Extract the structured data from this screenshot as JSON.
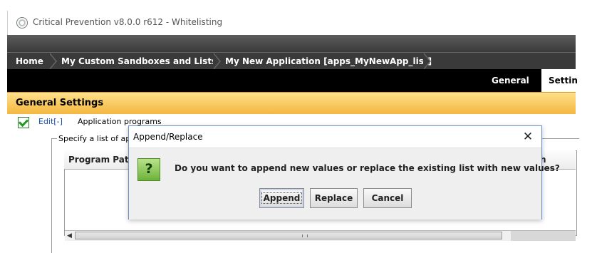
{
  "window": {
    "title": "Critical Prevention v8.0.0 r612 - Whitelisting"
  },
  "breadcrumb": [
    "Home",
    "My Custom Sandboxes and Lists",
    "My New Application [apps_MyNewApp_list]"
  ],
  "tabs": {
    "general": "General",
    "settings": "Settin"
  },
  "section": {
    "title": "General Settings"
  },
  "content": {
    "edit_link": "Edit[-]",
    "application_label": "Application programs",
    "legend": "Specify a list of ap",
    "table_header": "Program Path",
    "second_column_fragment": "h"
  },
  "dialog": {
    "title": "Append/Replace",
    "close": "✕",
    "icon_glyph": "?",
    "message": "Do you want to append new values or replace the existing list with new values?",
    "buttons": {
      "append": "Append",
      "replace": "Replace",
      "cancel": "Cancel"
    }
  },
  "colors": {
    "section_header": "#f4b740",
    "dialog_border": "#6f8fc7",
    "question_icon": "#6cb23a"
  }
}
